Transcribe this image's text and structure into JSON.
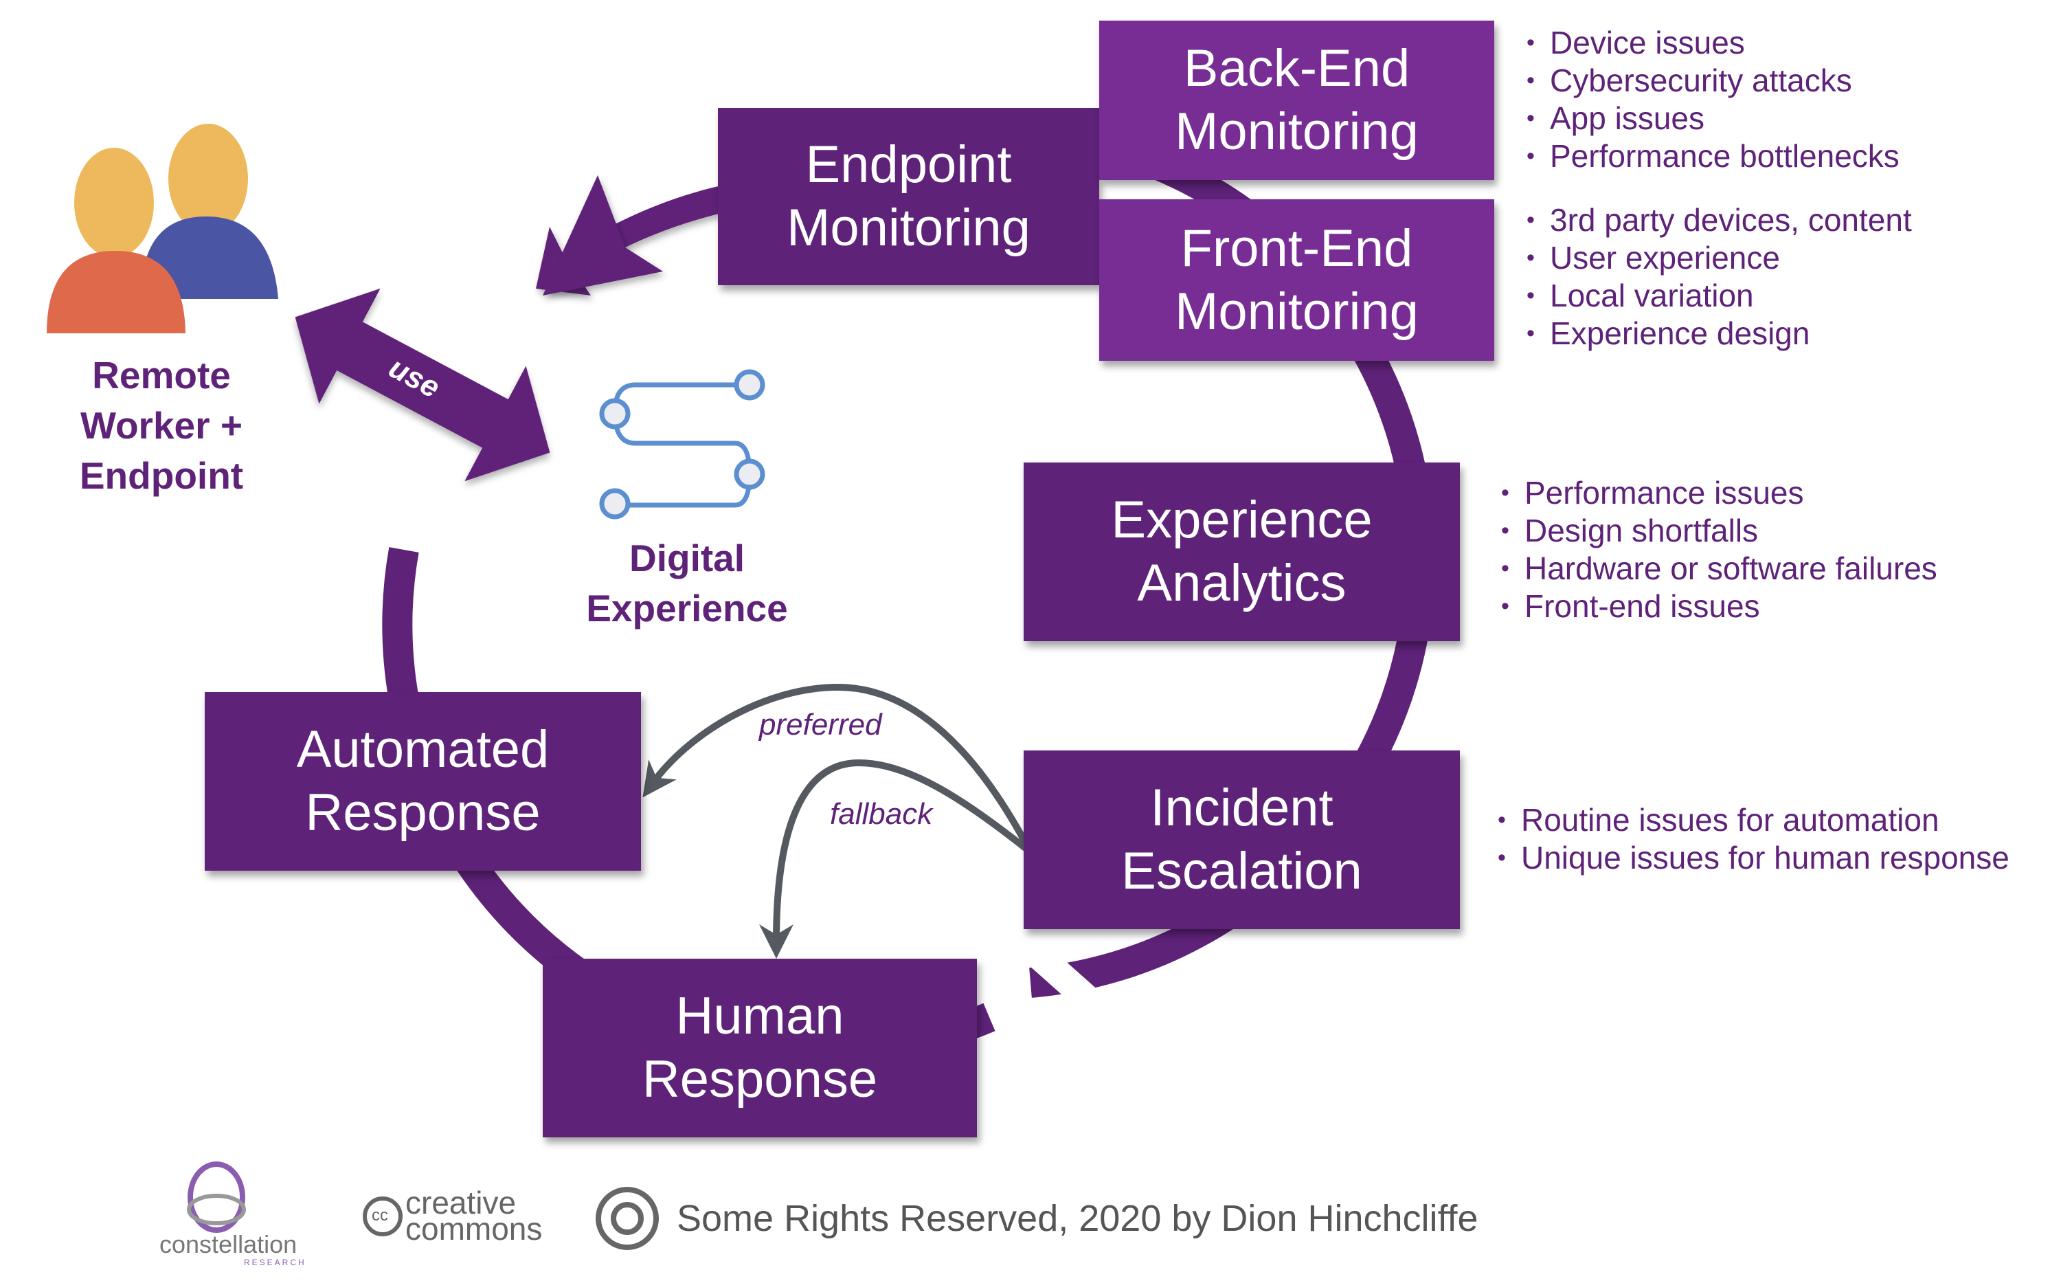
{
  "colors": {
    "primary_dark": "#5e2278",
    "primary_light": "#772d94",
    "flow_arrow_gray": "#545a60",
    "icon_blue": "#5b8fd0",
    "person_head": "#eeb95c",
    "person_front_body": "#df6a4b",
    "person_back_body": "#4a55a3"
  },
  "actor": {
    "label": "Remote\nWorker +\nEndpoint",
    "icon": "users-icon"
  },
  "use_arrow": {
    "label": "use"
  },
  "center": {
    "label": "Digital\nExperience",
    "icon": "digital-path-icon"
  },
  "stages": {
    "endpoint": {
      "label": "Endpoint\nMonitoring"
    },
    "backend": {
      "label": "Back-End\nMonitoring"
    },
    "frontend": {
      "label": "Front-End\nMonitoring"
    },
    "analytics": {
      "label": "Experience\nAnalytics"
    },
    "escalation": {
      "label": "Incident\nEscalation"
    },
    "automated": {
      "label": "Automated\nResponse"
    },
    "human": {
      "label": "Human\nResponse"
    }
  },
  "notes": {
    "backend": [
      "Device issues",
      "Cybersecurity attacks",
      "App issues",
      "Performance bottlenecks"
    ],
    "frontend": [
      "3rd party devices, content",
      "User experience",
      "Local variation",
      "Experience design"
    ],
    "analytics": [
      "Performance issues",
      "Design shortfalls",
      "Hardware or software failures",
      "Front-end issues"
    ],
    "escalation": [
      "Routine issues for automation",
      "Unique issues for human response"
    ]
  },
  "escalation_paths": {
    "preferred": "preferred",
    "fallback": "fallback"
  },
  "footer": {
    "logo_text": "constellation",
    "logo_subtext": "RESEARCH",
    "cc_line1": "creative",
    "cc_line2": "commons",
    "cc_badge": "cc",
    "rights": "Some Rights Reserved, 2020 by Dion Hinchcliffe"
  }
}
